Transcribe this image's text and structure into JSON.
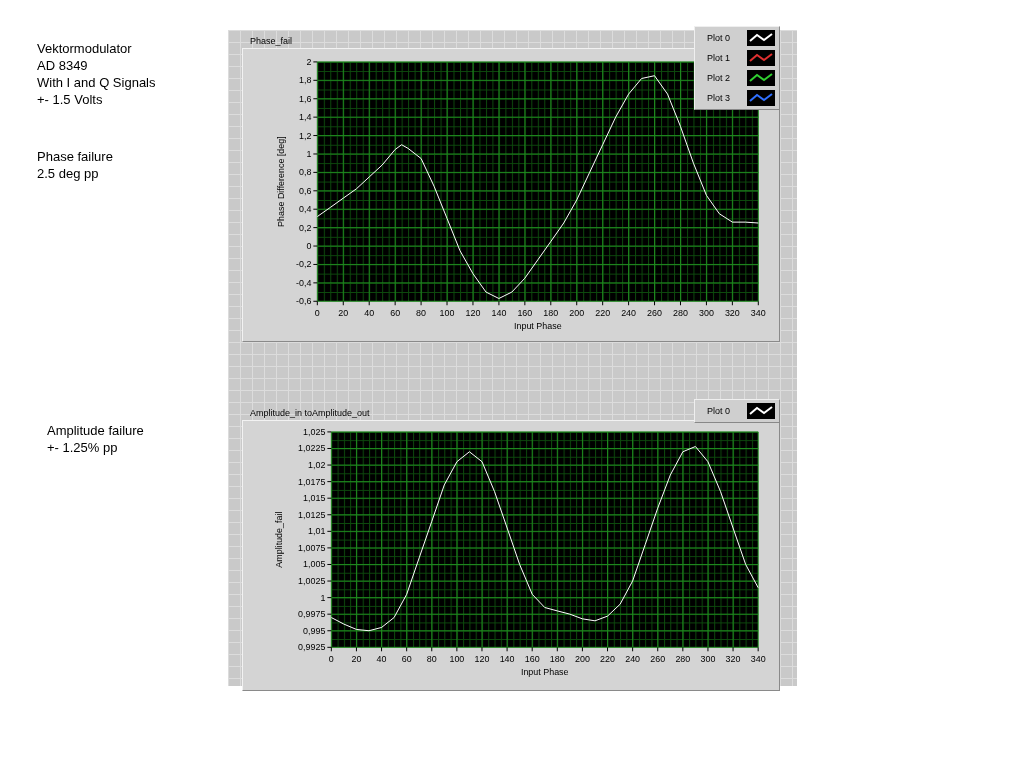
{
  "notes": [
    {
      "lines": [
        "Vektormodulator",
        "AD 8349",
        "With I and Q Signals",
        "+- 1.5 Volts"
      ]
    },
    {
      "lines": [
        "Phase failure",
        "2.5 deg pp"
      ]
    },
    {
      "lines": [
        "Amplitude failure",
        "+- 1.25% pp"
      ]
    }
  ],
  "graphs": [
    {
      "title": "Phase_fail",
      "legend": [
        {
          "label": "Plot 0",
          "color": "#ffffff"
        },
        {
          "label": "Plot 1",
          "color": "#e03030"
        },
        {
          "label": "Plot 2",
          "color": "#30d030"
        },
        {
          "label": "Plot 3",
          "color": "#3070ff"
        }
      ],
      "chart_data": {
        "type": "line",
        "grid": true,
        "xlabel": "Input Phase",
        "ylabel": "Phase Difference [deg]",
        "xlim": [
          0,
          340
        ],
        "ylim": [
          -0.6,
          2
        ],
        "x": [
          0,
          10,
          20,
          30,
          40,
          50,
          60,
          65,
          70,
          80,
          90,
          100,
          110,
          120,
          130,
          140,
          150,
          160,
          170,
          180,
          190,
          200,
          210,
          220,
          230,
          240,
          250,
          260,
          270,
          280,
          290,
          300,
          310,
          320,
          330,
          340
        ],
        "series": [
          {
            "color": "#ffffff",
            "values": [
              0.32,
              0.42,
              0.52,
              0.62,
              0.75,
              0.88,
              1.05,
              1.1,
              1.06,
              0.95,
              0.65,
              0.3,
              -0.05,
              -0.3,
              -0.5,
              -0.57,
              -0.5,
              -0.35,
              -0.15,
              0.05,
              0.25,
              0.5,
              0.8,
              1.1,
              1.4,
              1.65,
              1.82,
              1.85,
              1.65,
              1.3,
              0.9,
              0.55,
              0.35,
              0.26,
              0.26,
              0.25
            ]
          }
        ],
        "xticks": [
          0,
          20,
          40,
          60,
          80,
          100,
          120,
          140,
          160,
          180,
          200,
          220,
          240,
          260,
          280,
          300,
          320,
          340
        ],
        "yticks": [
          {
            "value": 2,
            "label": "2"
          },
          {
            "value": 1.8,
            "label": "1,8"
          },
          {
            "value": 1.6,
            "label": "1,6"
          },
          {
            "value": 1.4,
            "label": "1,4"
          },
          {
            "value": 1.2,
            "label": "1,2"
          },
          {
            "value": 1,
            "label": "1"
          },
          {
            "value": 0.8,
            "label": "0,8"
          },
          {
            "value": 0.6,
            "label": "0,6"
          },
          {
            "value": 0.4,
            "label": "0,4"
          },
          {
            "value": 0.2,
            "label": "0,2"
          },
          {
            "value": 0,
            "label": "0"
          },
          {
            "value": -0.2,
            "label": "-0,2"
          },
          {
            "value": -0.4,
            "label": "-0,4"
          },
          {
            "value": -0.6,
            "label": "-0,6"
          }
        ]
      }
    },
    {
      "title": "Amplitude_in toAmplitude_out",
      "legend": [
        {
          "label": "Plot 0",
          "color": "#ffffff"
        }
      ],
      "chart_data": {
        "type": "line",
        "grid": true,
        "xlabel": "Input Phase",
        "ylabel": "Amplitude_fail",
        "xlim": [
          0,
          340
        ],
        "ylim": [
          0.9925,
          1.025
        ],
        "x": [
          0,
          10,
          20,
          30,
          40,
          50,
          60,
          70,
          80,
          90,
          100,
          110,
          120,
          130,
          140,
          150,
          160,
          170,
          180,
          190,
          200,
          210,
          220,
          230,
          240,
          250,
          260,
          270,
          280,
          290,
          300,
          310,
          320,
          330,
          340
        ],
        "series": [
          {
            "color": "#ffffff",
            "values": [
              0.997,
              0.996,
              0.9952,
              0.995,
              0.9955,
              0.997,
              1.0005,
              1.006,
              1.0115,
              1.017,
              1.0205,
              1.022,
              1.0205,
              1.016,
              1.0105,
              1.005,
              1.0005,
              0.9985,
              0.998,
              0.9975,
              0.9968,
              0.9965,
              0.9972,
              0.999,
              1.0025,
              1.008,
              1.0135,
              1.0185,
              1.022,
              1.0228,
              1.0205,
              1.016,
              1.0105,
              1.005,
              1.0015
            ]
          }
        ],
        "xticks": [
          0,
          20,
          40,
          60,
          80,
          100,
          120,
          140,
          160,
          180,
          200,
          220,
          240,
          260,
          280,
          300,
          320,
          340
        ],
        "yticks": [
          {
            "value": 1.025,
            "label": "1,025"
          },
          {
            "value": 1.0225,
            "label": "1,0225"
          },
          {
            "value": 1.02,
            "label": "1,02"
          },
          {
            "value": 1.0175,
            "label": "1,0175"
          },
          {
            "value": 1.015,
            "label": "1,015"
          },
          {
            "value": 1.0125,
            "label": "1,0125"
          },
          {
            "value": 1.01,
            "label": "1,01"
          },
          {
            "value": 1.0075,
            "label": "1,0075"
          },
          {
            "value": 1.005,
            "label": "1,005"
          },
          {
            "value": 1.0025,
            "label": "1,0025"
          },
          {
            "value": 1,
            "label": "1"
          },
          {
            "value": 0.9975,
            "label": "0,9975"
          },
          {
            "value": 0.995,
            "label": "0,995"
          },
          {
            "value": 0.9925,
            "label": "0,9925"
          }
        ]
      }
    }
  ]
}
